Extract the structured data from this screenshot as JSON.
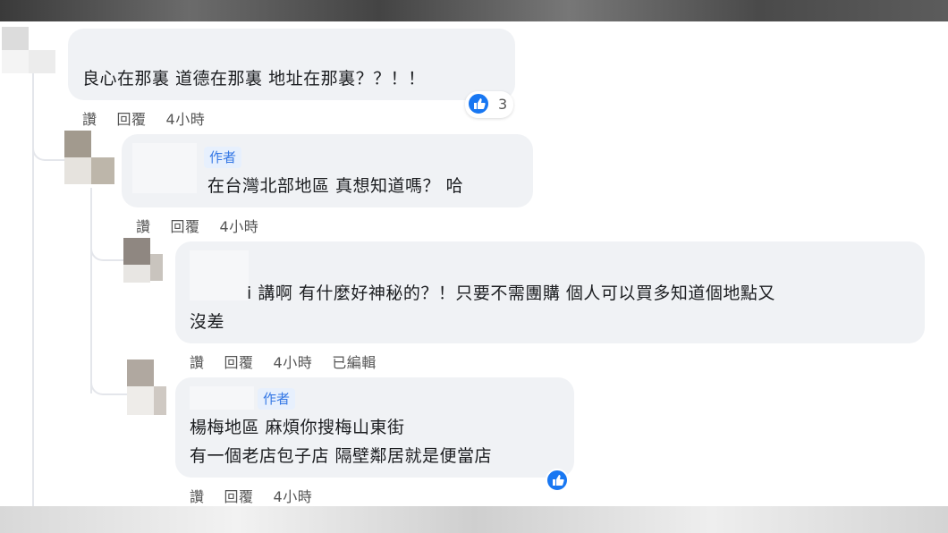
{
  "comments": [
    {
      "text": "良心在那裏 道德在那裏 地址在那裏？？！！",
      "actions": {
        "like": "讚",
        "reply": "回覆",
        "time": "4小時"
      },
      "reactions": {
        "icon": "thumbs-up-icon",
        "count": "3"
      }
    },
    {
      "badge": "作者",
      "text": "在台灣北部地區 真想知道嗎？ 哈",
      "actions": {
        "like": "讚",
        "reply": "回覆",
        "time": "4小時"
      }
    },
    {
      "text_line1": "i 講啊 有什麼好神秘的？！只要不需團購 個人可以買多知道個地點又",
      "text_line2": "沒差",
      "actions": {
        "like": "讚",
        "reply": "回覆",
        "time": "4小時",
        "edited": "已編輯"
      }
    },
    {
      "badge": "作者",
      "text_line1": "楊梅地區 麻煩你搜梅山東街",
      "text_line2": "有一個老店包子店 隔壁鄰居就是便當店",
      "actions": {
        "like": "讚",
        "reply": "回覆",
        "time": "4小時"
      },
      "reactions": {
        "icon": "thumbs-up-icon"
      }
    }
  ],
  "colors": {
    "bubble": "#f0f2f5",
    "like_blue": "#1877f2",
    "badge_text": "#3578e5"
  }
}
